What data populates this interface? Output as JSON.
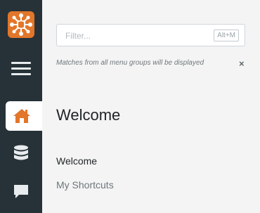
{
  "sidebar": {
    "logo_icon": "app-logo-icon",
    "menu_icon": "hamburger-icon",
    "items": [
      {
        "icon": "home-icon",
        "active": true
      },
      {
        "icon": "database-icon",
        "active": false
      },
      {
        "icon": "chat-icon",
        "active": false
      }
    ]
  },
  "filter": {
    "placeholder": "Filter...",
    "value": "",
    "shortcut": "Alt+M",
    "hint": "Matches from all menu groups will be displayed",
    "close_label": "×"
  },
  "content": {
    "title": "Welcome",
    "items": [
      {
        "label": "Welcome"
      },
      {
        "label": "My Shortcuts"
      }
    ]
  },
  "colors": {
    "rail": "#263238",
    "accent": "#e2762a",
    "panel": "#f4f4f4"
  }
}
